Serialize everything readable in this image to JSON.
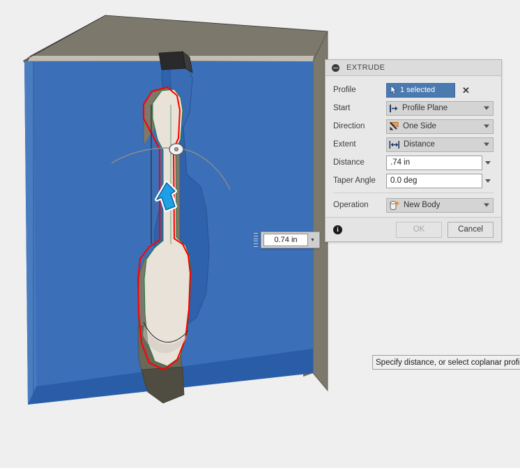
{
  "app": {
    "canvas_background": "#efefef"
  },
  "viewport": {
    "name": "3d-modeling-viewport",
    "sketch_plane_color": "#3b6fb8",
    "sketch_plane_shadow_color": "#2a5da8",
    "body_top_face_color": "#7d786c",
    "profile_fill_color": "#e8e2d9",
    "profile_outline_color": "#ff0000",
    "preview_body_color": "#2f62ad",
    "manipulator_arrow_color": "#1ea0e6",
    "dimension": {
      "value": "0.74 in",
      "grip_name": "dimension-drag-grip"
    }
  },
  "dialog": {
    "title": "EXTRUDE",
    "collapse_icon": "minus-circle-icon",
    "rows": {
      "profile": {
        "label": "Profile",
        "selection_text": "1 selected",
        "selection_icon": "cursor-arrow-icon",
        "clear_label": "✕"
      },
      "start": {
        "label": "Start",
        "value": "Profile Plane",
        "icon": "profile-plane-icon"
      },
      "direction": {
        "label": "Direction",
        "value": "One Side",
        "icon": "one-side-arrow-icon"
      },
      "extent": {
        "label": "Extent",
        "value": "Distance",
        "icon": "distance-arrows-icon"
      },
      "distance": {
        "label": "Distance",
        "value": ".74 in"
      },
      "taper_angle": {
        "label": "Taper Angle",
        "value": "0.0 deg"
      },
      "operation": {
        "label": "Operation",
        "value": "New Body",
        "icon": "new-body-cylinder-icon"
      }
    },
    "footer": {
      "info_icon": "info-icon",
      "info_glyph": "i",
      "ok_label": "OK",
      "cancel_label": "Cancel"
    }
  },
  "status": {
    "message": "Specify distance, or select coplanar profiles"
  }
}
